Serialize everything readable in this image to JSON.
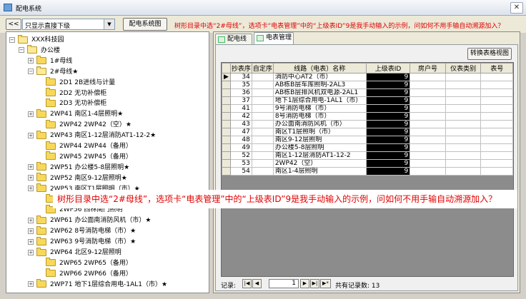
{
  "window": {
    "title": "配电系统",
    "close_glyph": "✕"
  },
  "toolbar": {
    "back_label": "<<",
    "filter_value": "只显示直接下级",
    "diagram_button": "配电系统图",
    "note": "树形目录中选“2#母线”，选项卡“电表管理”中的“上级表ID”9是我手动输入的示例，问如何不用手输自动溯源加入？"
  },
  "tree": {
    "items": [
      {
        "label": "XXX科技园",
        "expander": "−"
      },
      {
        "label": "办公楼",
        "expander": "−"
      },
      {
        "label": "1#母线",
        "expander": "+"
      },
      {
        "label": "2#母线★",
        "expander": "−"
      },
      {
        "label": "2D1  2B进线与计量",
        "expander": ""
      },
      {
        "label": "2D2  无功补偿柜",
        "expander": ""
      },
      {
        "label": "2D3  无功补偿柜",
        "expander": ""
      },
      {
        "label": "2WP41  南区1-4层照明★",
        "expander": "+"
      },
      {
        "label": "2WP42  2WP42（空）★",
        "expander": ""
      },
      {
        "label": "2WP43  南区1-12层消防AT1-12-2★",
        "expander": "+"
      },
      {
        "label": "2WP44  2WP44（备用）",
        "expander": ""
      },
      {
        "label": "2WP45  2WP45（备用）",
        "expander": ""
      },
      {
        "label": "2WP51  办公楼5-8层照明★",
        "expander": "+"
      },
      {
        "label": "2WP52  南区9-12层照明★",
        "expander": "+"
      },
      {
        "label": "2WP53  南区T1层照明（市）★",
        "expander": "+"
      },
      {
        "label": "2WP54  1#配电房照明ALD1",
        "expander": ""
      },
      {
        "label": "2WP56  西林南门照明",
        "expander": ""
      },
      {
        "label": "2WP61  办公面南消防风机（市）★",
        "expander": "+"
      },
      {
        "label": "2WP62  8号消防电梯（市）★",
        "expander": "+"
      },
      {
        "label": "2WP63  9号消防电梯（市）★",
        "expander": "+"
      },
      {
        "label": "2WP64  北区9-12层照明",
        "expander": "+"
      },
      {
        "label": "2WP65  2WP65（备用）",
        "expander": ""
      },
      {
        "label": "2WP66  2WP66（备用）",
        "expander": ""
      },
      {
        "label": "2WP71  地下1层综合用电-1AL1（市）★",
        "expander": "+"
      }
    ]
  },
  "tabs": [
    {
      "label": "配电线路"
    },
    {
      "label": "电表管理"
    }
  ],
  "panel": {
    "convert_button": "转换表格视图"
  },
  "table": {
    "columns": [
      "抄表序",
      "自定序",
      "线路（电表）名称",
      "上级表ID",
      "房户号",
      "仪表类别",
      "表号"
    ],
    "row_marker": "▶",
    "rows": [
      {
        "seq": "34",
        "name": "消防中心AT2（市）",
        "parent_id": "9"
      },
      {
        "seq": "35",
        "name": "AB栋B层车库照明-2AL3",
        "parent_id": "9"
      },
      {
        "seq": "36",
        "name": "AB栋B层排风机双电源-2AL1",
        "parent_id": "9"
      },
      {
        "seq": "37",
        "name": "地下1层综合用电-1AL1（市）",
        "parent_id": "9"
      },
      {
        "seq": "41",
        "name": "9号消防电梯（市）",
        "parent_id": "9"
      },
      {
        "seq": "42",
        "name": "8号消防电梯（市）",
        "parent_id": "9"
      },
      {
        "seq": "43",
        "name": "办公面南消防风机（市）",
        "parent_id": "9"
      },
      {
        "seq": "47",
        "name": "南区T1层照明（市）",
        "parent_id": "9"
      },
      {
        "seq": "48",
        "name": "南区9-12层照明",
        "parent_id": "9"
      },
      {
        "seq": "49",
        "name": "办公楼5-8层照明",
        "parent_id": "9"
      },
      {
        "seq": "52",
        "name": "南区1-12层消防AT1-12-2",
        "parent_id": "9"
      },
      {
        "seq": "53",
        "name": "2WP42（空）",
        "parent_id": "9"
      },
      {
        "seq": "54",
        "name": "南区1-4层照明",
        "parent_id": "9"
      }
    ]
  },
  "navigator": {
    "label": "记录:",
    "current": "1",
    "total_text": "共有记录数: 13",
    "first_glyph": "|◀",
    "prev_glyph": "◀",
    "next_glyph": "▶",
    "last_glyph": "▶|",
    "new_glyph": "▶*"
  },
  "overlay_note": "树形目录中选“2#母线”，选项卡“电表管理”中的“上级表ID”9是我手动输入的示例，问如何不用手输自动溯源加入？",
  "colors": {
    "note_red": "#e00000",
    "folder_yellow": "#f7d85a",
    "parent_id_bg": "#000000"
  }
}
